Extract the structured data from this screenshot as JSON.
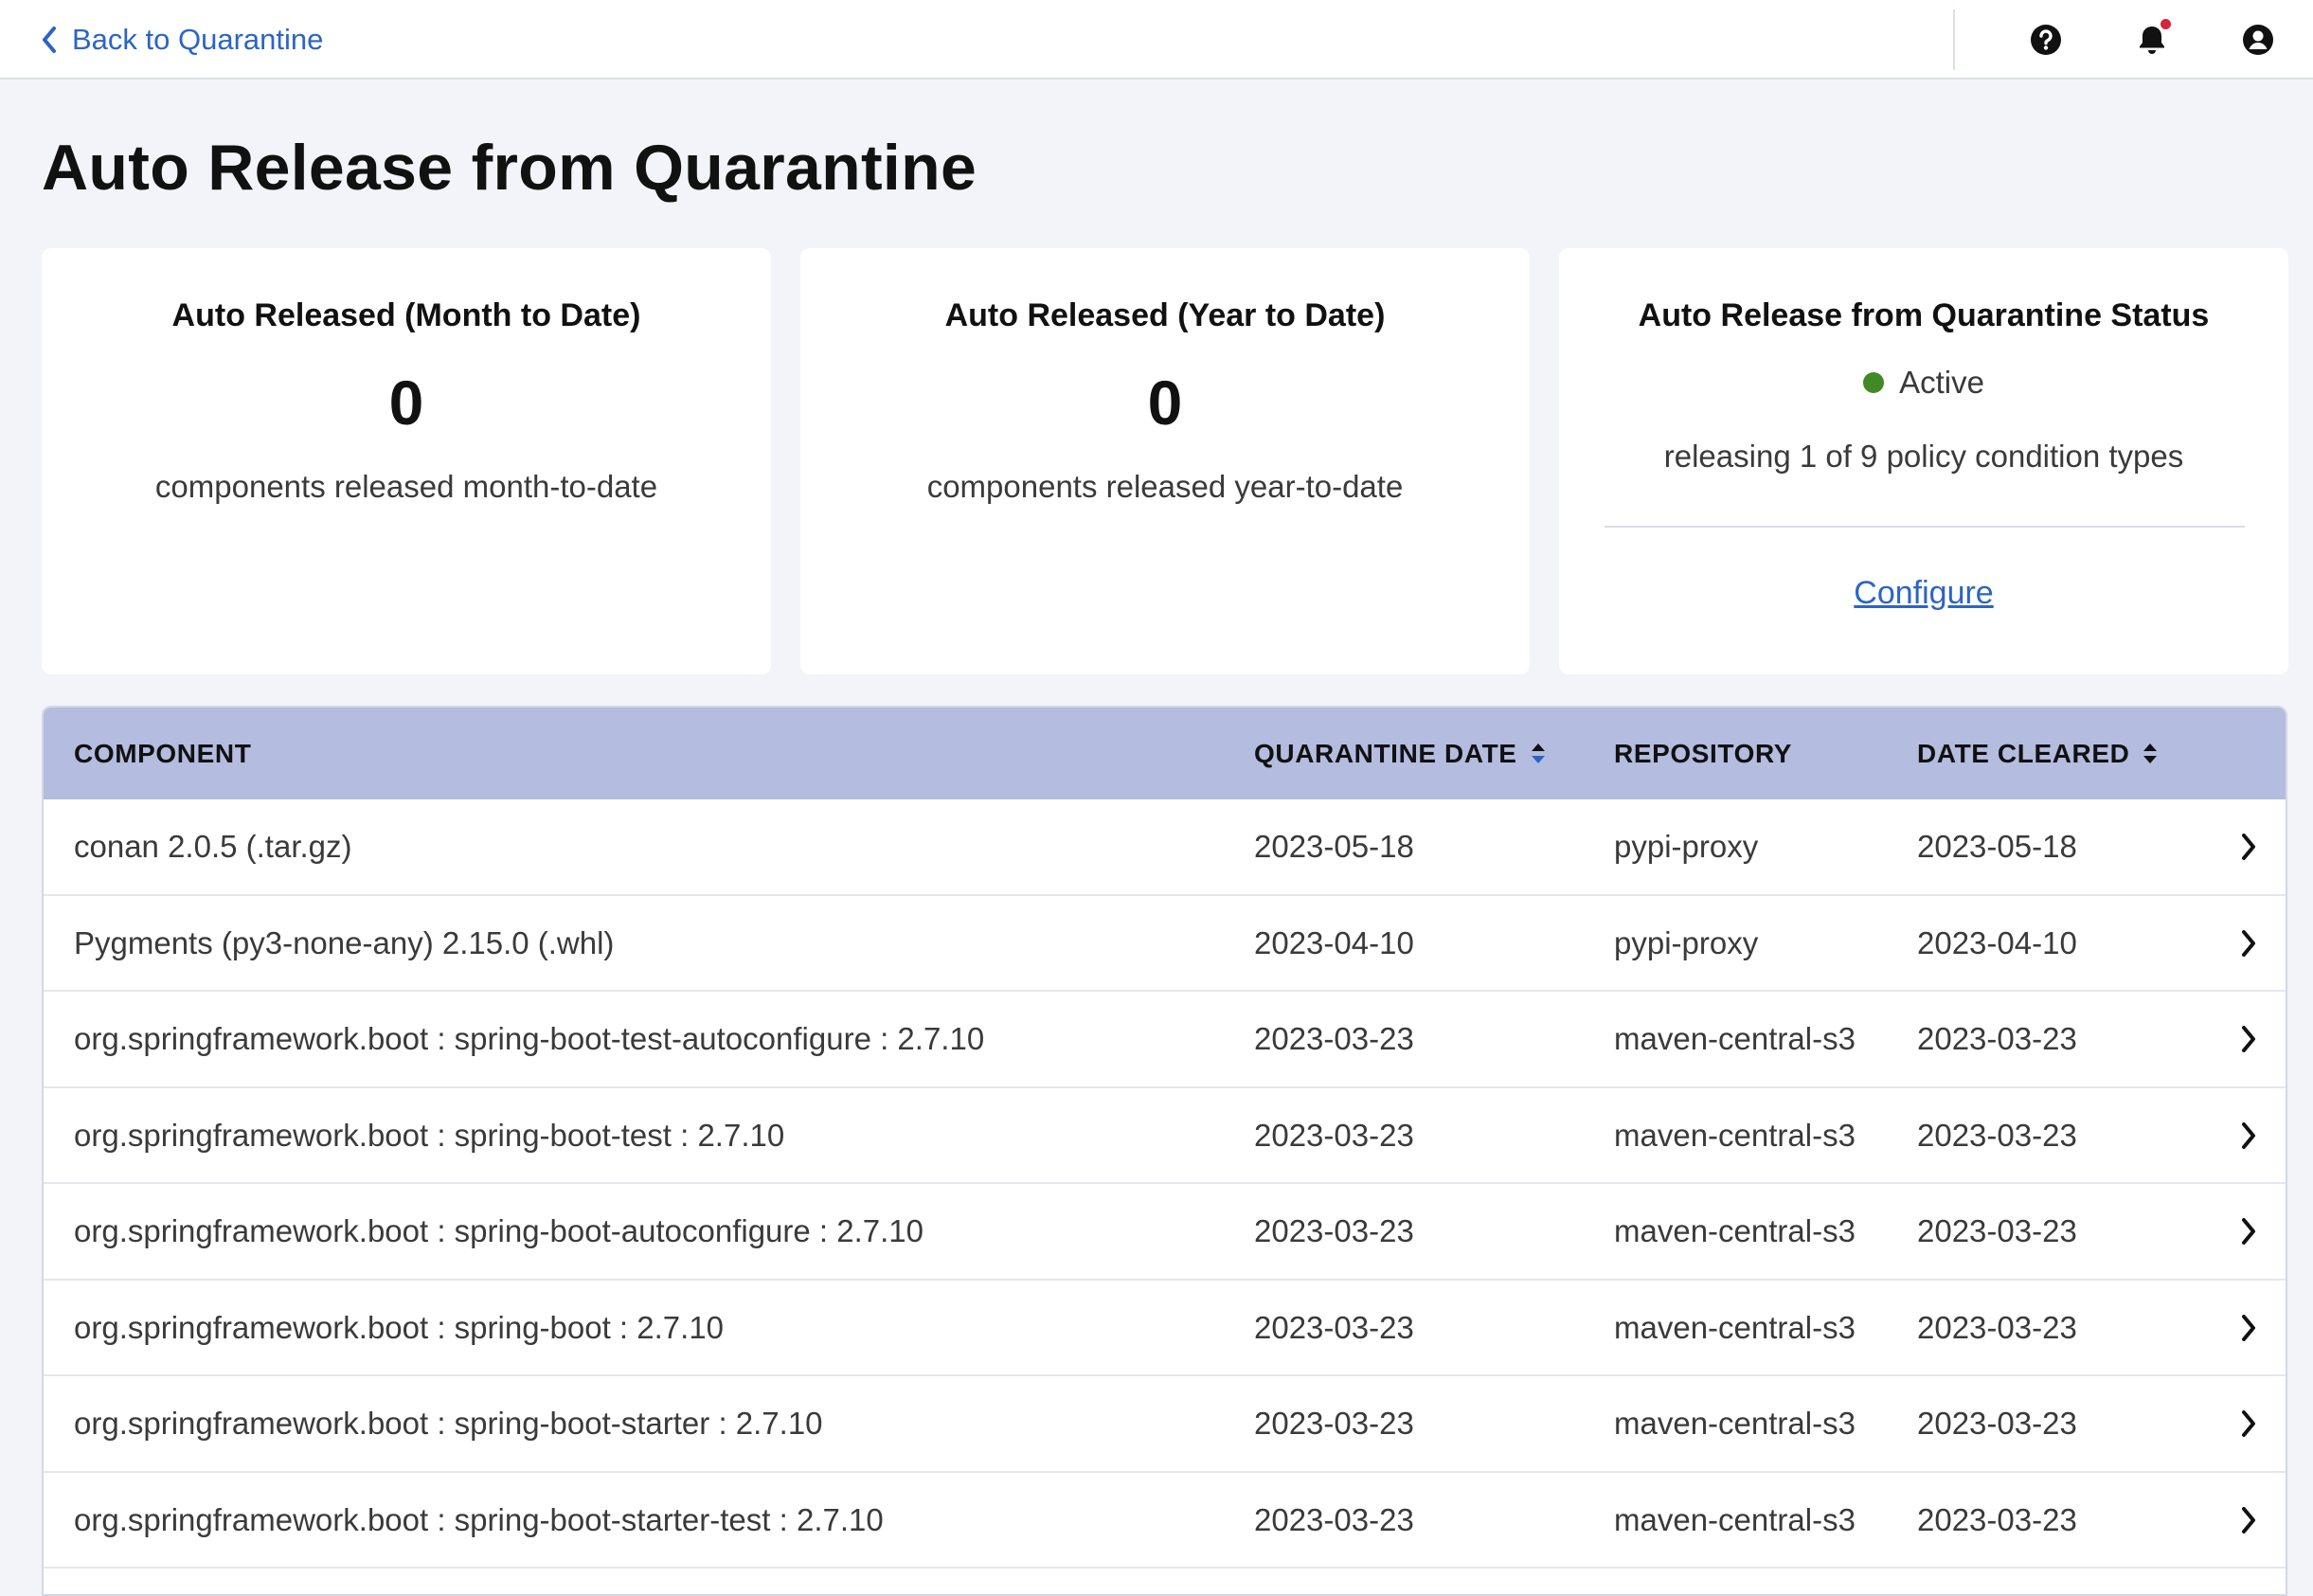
{
  "header": {
    "back_label": "Back to Quarantine",
    "icons": [
      "help-icon",
      "bell-icon",
      "user-icon"
    ],
    "has_unread_notifications": true
  },
  "page": {
    "title": "Auto Release from Quarantine"
  },
  "cards": {
    "month": {
      "title": "Auto Released (Month to Date)",
      "value": "0",
      "description": "components released month-to-date"
    },
    "year": {
      "title": "Auto Released (Year to Date)",
      "value": "0",
      "description": "components released year-to-date"
    },
    "status": {
      "title": "Auto Release from Quarantine Status",
      "state": "Active",
      "description": "releasing 1 of 9 policy condition types",
      "configure_label": "Configure"
    }
  },
  "table": {
    "columns": {
      "component": "COMPONENT",
      "quarantine_date": "QUARANTINE DATE",
      "repository": "REPOSITORY",
      "date_cleared": "DATE CLEARED"
    },
    "rows": [
      {
        "component": "conan 2.0.5 (.tar.gz)",
        "quarantine_date": "2023-05-18",
        "repository": "pypi-proxy",
        "date_cleared": "2023-05-18"
      },
      {
        "component": "Pygments (py3-none-any) 2.15.0 (.whl)",
        "quarantine_date": "2023-04-10",
        "repository": "pypi-proxy",
        "date_cleared": "2023-04-10"
      },
      {
        "component": "org.springframework.boot : spring-boot-test-autoconfigure : 2.7.10",
        "quarantine_date": "2023-03-23",
        "repository": "maven-central-s3",
        "date_cleared": "2023-03-23"
      },
      {
        "component": "org.springframework.boot : spring-boot-test : 2.7.10",
        "quarantine_date": "2023-03-23",
        "repository": "maven-central-s3",
        "date_cleared": "2023-03-23"
      },
      {
        "component": "org.springframework.boot : spring-boot-autoconfigure : 2.7.10",
        "quarantine_date": "2023-03-23",
        "repository": "maven-central-s3",
        "date_cleared": "2023-03-23"
      },
      {
        "component": "org.springframework.boot : spring-boot : 2.7.10",
        "quarantine_date": "2023-03-23",
        "repository": "maven-central-s3",
        "date_cleared": "2023-03-23"
      },
      {
        "component": "org.springframework.boot : spring-boot-starter : 2.7.10",
        "quarantine_date": "2023-03-23",
        "repository": "maven-central-s3",
        "date_cleared": "2023-03-23"
      },
      {
        "component": "org.springframework.boot : spring-boot-starter-test : 2.7.10",
        "quarantine_date": "2023-03-23",
        "repository": "maven-central-s3",
        "date_cleared": "2023-03-23"
      }
    ]
  },
  "colors": {
    "link": "#2c64c6",
    "status_active": "#3f8a24",
    "table_header_bg": "#b4bcdf",
    "notification_dot": "#d5263b",
    "sort_active": "#2c64c6"
  }
}
